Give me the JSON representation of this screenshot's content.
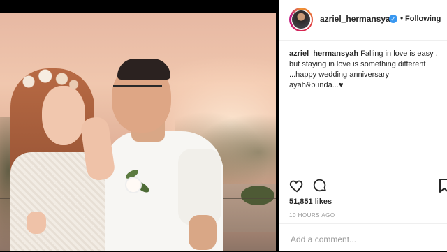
{
  "post": {
    "photo_alt": "wedding anniversary couple photo"
  },
  "header": {
    "username": "azriel_hermansyah",
    "verified_icon": "verified-badge-icon",
    "separator": "•",
    "follow_status": "Following"
  },
  "caption": {
    "username": "azriel_hermansyah",
    "text": " Falling in love is easy , but staying in love is something different ...happy wedding anniversary ayah&bunda...♥"
  },
  "actions": {
    "like_icon": "heart-icon",
    "comment_icon": "comment-icon",
    "save_icon": "bookmark-icon"
  },
  "stats": {
    "likes": "51,851 likes",
    "timestamp": "10 HOURS AGO"
  },
  "comment_box": {
    "placeholder": "Add a comment..."
  },
  "colors": {
    "verified": "#3897f0",
    "text": "#262626",
    "muted": "#999999"
  }
}
